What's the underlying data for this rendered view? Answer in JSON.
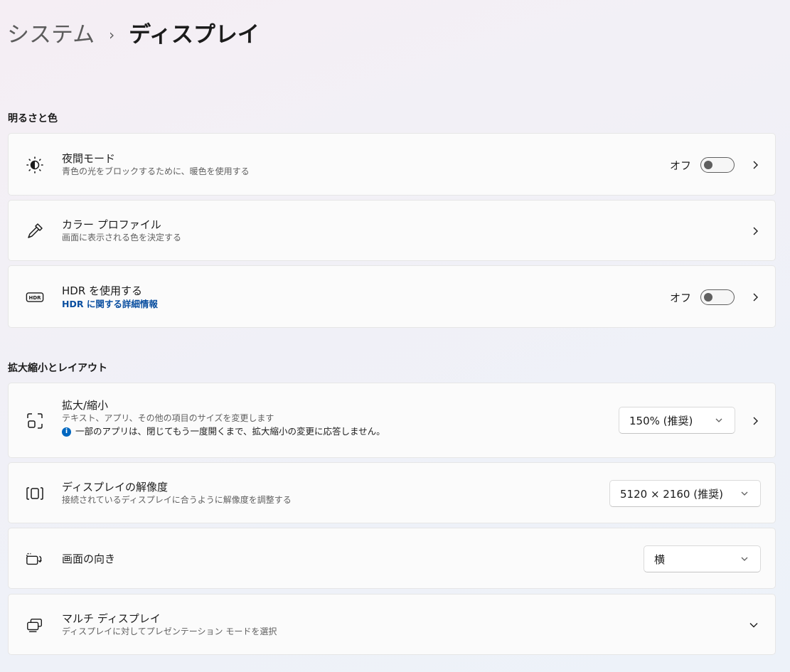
{
  "breadcrumb": {
    "parent": "システム",
    "separator": "›",
    "current": "ディスプレイ"
  },
  "sections": {
    "brightness": "明るさと色",
    "scale": "拡大縮小とレイアウト"
  },
  "night_mode": {
    "icon": "brightness-icon",
    "title": "夜間モード",
    "subtitle": "青色の光をブロックするために、暖色を使用する",
    "toggle_label": "オフ",
    "toggle_on": false
  },
  "color_profile": {
    "icon": "eyedropper-icon",
    "title": "カラー プロファイル",
    "subtitle": "画面に表示される色を決定する"
  },
  "hdr": {
    "icon": "hdr-icon",
    "badge": "HDR",
    "title": "HDR を使用する",
    "link": "HDR に関する詳細情報",
    "toggle_label": "オフ",
    "toggle_on": false
  },
  "scale": {
    "icon": "scale-icon",
    "title": "拡大/縮小",
    "subtitle": "テキスト、アプリ、その他の項目のサイズを変更します",
    "note": "一部のアプリは、閉じてもう一度開くまで、拡大縮小の変更に応答しません。",
    "info_glyph": "i",
    "value": "150% (推奨)"
  },
  "resolution": {
    "icon": "resolution-icon",
    "title": "ディスプレイの解像度",
    "subtitle": "接続されているディスプレイに合うように解像度を調整する",
    "value": "5120 × 2160 (推奨)"
  },
  "orientation": {
    "icon": "orientation-icon",
    "title": "画面の向き",
    "value": "横"
  },
  "multi_display": {
    "icon": "multi-display-icon",
    "title": "マルチ ディスプレイ",
    "subtitle": "ディスプレイに対してプレゼンテーション モードを選択"
  },
  "colors": {
    "link": "#0a4fa0",
    "info": "#0067c0",
    "toggle_off": "#5f5f5f"
  }
}
